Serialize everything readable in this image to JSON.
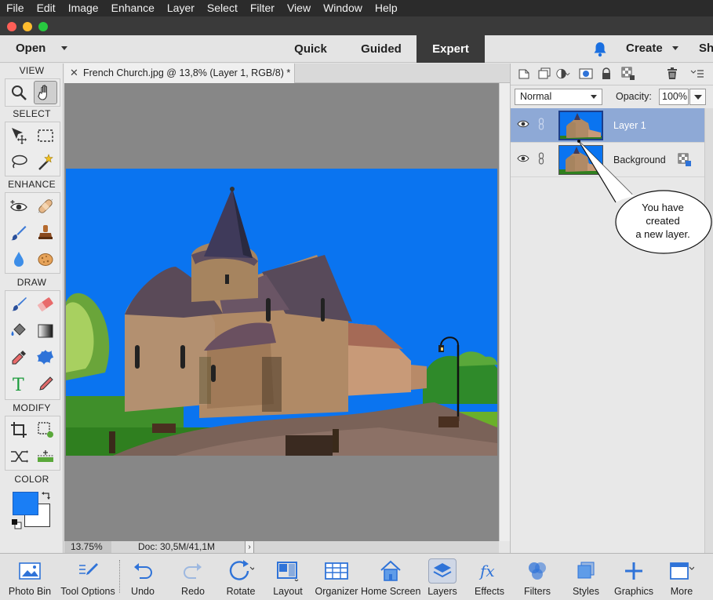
{
  "menubar": {
    "items": [
      "File",
      "Edit",
      "Image",
      "Enhance",
      "Layer",
      "Select",
      "Filter",
      "View",
      "Window",
      "Help"
    ]
  },
  "apptoolbar": {
    "open_label": "Open",
    "modes": {
      "quick": "Quick",
      "guided": "Guided",
      "expert": "Expert"
    },
    "active_mode": "Expert",
    "create_label": "Create",
    "share_label": "Sh"
  },
  "tools": {
    "sections": {
      "view": "VIEW",
      "select": "SELECT",
      "enhance": "ENHANCE",
      "draw": "DRAW",
      "modify": "MODIFY",
      "color": "COLOR"
    },
    "foreground_color": "#1a7ef5",
    "background_color": "#ffffff"
  },
  "document": {
    "tab_title": "French Church.jpg @ 13,8% (Layer 1, RGB/8) *",
    "zoom": "13.75%",
    "doc_size": "Doc: 30,5M/41,1M"
  },
  "layers_panel": {
    "blend_mode": "Normal",
    "opacity_label": "Opacity:",
    "opacity_value": "100%",
    "layers": [
      {
        "name": "Layer 1",
        "selected": true
      },
      {
        "name": "Background",
        "selected": false
      }
    ]
  },
  "callout": {
    "line1": "You have",
    "line2": "created",
    "line3": "a new layer."
  },
  "taskbar": {
    "items": [
      "Photo Bin",
      "Tool Options",
      "Undo",
      "Redo",
      "Rotate",
      "Layout",
      "Organizer",
      "Home Screen",
      "Layers",
      "Effects",
      "Filters",
      "Styles",
      "Graphics",
      "More"
    ],
    "active": "Layers"
  }
}
